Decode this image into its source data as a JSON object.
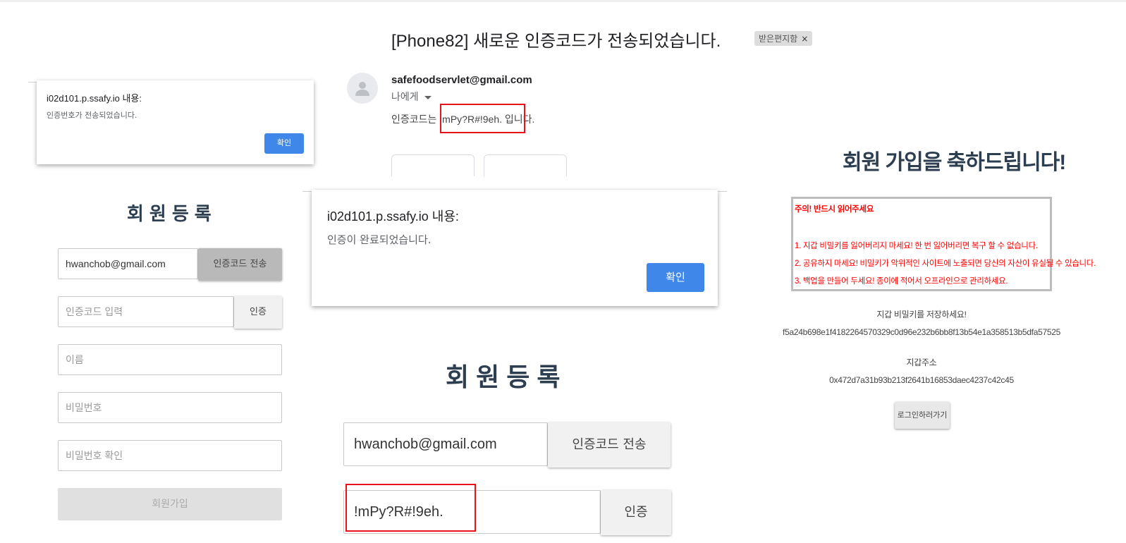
{
  "email": {
    "subject": "[Phone82] 새로운 인증코드가 전송되었습니다.",
    "label": "받은편지함",
    "label_close": "×",
    "sender": "safefoodservlet@gmail.com",
    "recipient": "나에게",
    "body_prefix": "인증코드는 ",
    "code": "!mPy?R#!9eh.",
    "body_suffix": " 입니다."
  },
  "dialog_small": {
    "title": "i02d101.p.ssafy.io 내용:",
    "message": "인증번호가 전송되었습니다.",
    "ok": "확인"
  },
  "dialog_large": {
    "title": "i02d101.p.ssafy.io 내용:",
    "message": "인증이 완료되었습니다.",
    "ok": "확인"
  },
  "register_small": {
    "title": "회원등록",
    "email_value": "hwanchob@gmail.com",
    "send_code": "인증코드 전송",
    "code_placeholder": "인증코드 입력",
    "verify": "인증",
    "name_placeholder": "이름",
    "password_placeholder": "비밀번호",
    "password_confirm_placeholder": "비밀번호 확인",
    "join": "회원가입"
  },
  "register_large": {
    "title": "회원등록",
    "email_value": "hwanchob@gmail.com",
    "send_code": "인증코드 전송",
    "code_value": "!mPy?R#!9eh.",
    "verify": "인증"
  },
  "wallet": {
    "congrats": "회원 가입을 축하드립니다!",
    "warning_title": "주의! 반드시 읽어주세요",
    "warnings": [
      "1. 지갑 비밀키를 잃어버리지 마세요! 한 번 잃어버리면 복구 할 수 없습니다.",
      "2. 공유하지 마세요! 비밀키가 악위적인 사이트에 노출되면 당신의 자산이 유실될 수 있습니다.",
      "3. 백업을 만들어 두세요! 종이에 적어서 오프라인으로 관리하세요."
    ],
    "save_key_label": "지갑 비밀키를 저장하세요!",
    "private_key": "f5a24b698e1f4182264570329c0d96e232b6bb8f13b54e1a358513b5dfa57525",
    "address_label": "지갑주소",
    "address": "0x472d7a31b93b213f2641b16853daec4237c42c45",
    "login_button": "로그인하러가기"
  },
  "colors": {
    "accent_blue": "#3f87e8",
    "highlight_red": "#e8131a",
    "title_navy": "#2c3e50",
    "warning_red": "#ff0000"
  }
}
